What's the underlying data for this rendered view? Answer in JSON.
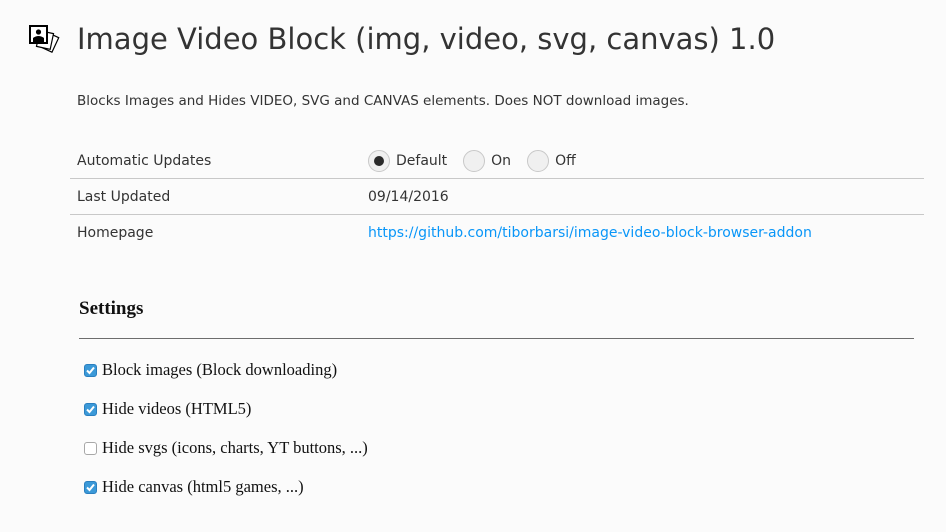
{
  "header": {
    "title": "Image Video Block (img, video, svg, canvas) 1.0",
    "icon": "image-block-icon"
  },
  "description": "Blocks Images and Hides VIDEO, SVG and CANVAS elements. Does NOT download images.",
  "details": {
    "auto_updates": {
      "label": "Automatic Updates",
      "options": [
        "Default",
        "On",
        "Off"
      ],
      "selected": "Default"
    },
    "last_updated": {
      "label": "Last Updated",
      "value": "09/14/2016"
    },
    "homepage": {
      "label": "Homepage",
      "value": "https://github.com/tiborbarsi/image-video-block-browser-addon"
    }
  },
  "settings": {
    "title": "Settings",
    "options": [
      {
        "label": "Block images (Block downloading)",
        "checked": true
      },
      {
        "label": "Hide videos (HTML5)",
        "checked": true
      },
      {
        "label": "Hide svgs (icons, charts, YT buttons, ...)",
        "checked": false
      },
      {
        "label": "Hide canvas (html5 games, ...)",
        "checked": true
      }
    ]
  },
  "colors": {
    "link": "#0996f8",
    "checkbox": "#3b99d8"
  }
}
